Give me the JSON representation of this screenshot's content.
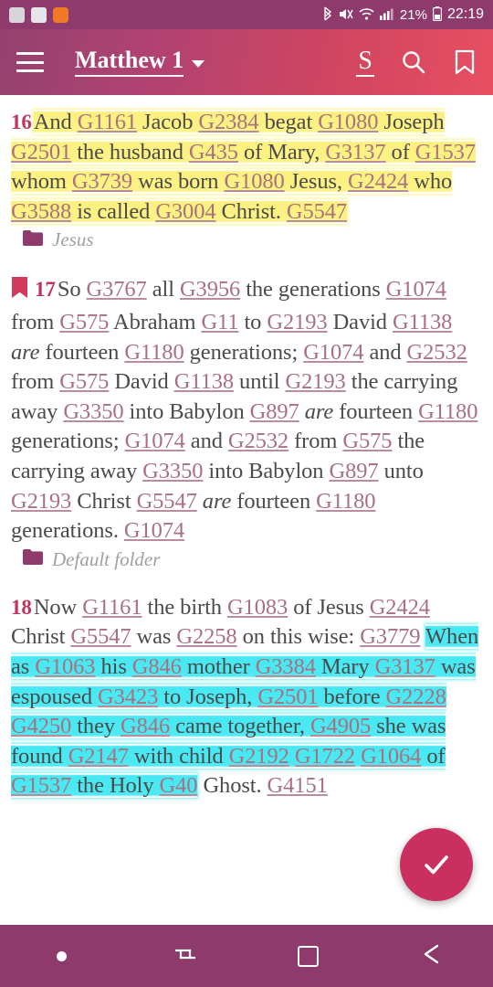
{
  "status_bar": {
    "app_icons": [
      "notification-app-icon-1",
      "gallery-app-icon",
      "orange-app-icon"
    ],
    "bluetooth_glyph": "B",
    "mute_glyph": "X",
    "wifi_glyph": "▰",
    "signal_glyph": "▂",
    "battery_percent": "21%",
    "battery_glyph": "▮",
    "time": "22:19"
  },
  "app_bar": {
    "menu_icon": "hamburger-menu-icon",
    "chapter": "Matthew 1",
    "chapter_caret": "chevron-down-icon",
    "strongs_label": "S",
    "search_icon": "search-icon",
    "bookmark_icon": "bookmark-icon"
  },
  "content": {
    "verses": [
      {
        "number": "16",
        "highlight": "yellow",
        "bookmark": false,
        "folder": "Jesus",
        "tokens": [
          {
            "t": "And ",
            "k": "text"
          },
          {
            "t": "G1161",
            "k": "strongs"
          },
          {
            "t": " Jacob ",
            "k": "text"
          },
          {
            "t": "G2384",
            "k": "strongs"
          },
          {
            "t": " begat ",
            "k": "text"
          },
          {
            "t": "G1080",
            "k": "strongs"
          },
          {
            "t": " Joseph ",
            "k": "text"
          },
          {
            "t": "G2501",
            "k": "strongs"
          },
          {
            "t": " the husband ",
            "k": "text"
          },
          {
            "t": "G435",
            "k": "strongs"
          },
          {
            "t": " of Mary, ",
            "k": "text"
          },
          {
            "t": "G3137",
            "k": "strongs"
          },
          {
            "t": " of ",
            "k": "text"
          },
          {
            "t": "G1537",
            "k": "strongs"
          },
          {
            "t": " whom ",
            "k": "text"
          },
          {
            "t": "G3739",
            "k": "strongs"
          },
          {
            "t": " was born ",
            "k": "text"
          },
          {
            "t": "G1080",
            "k": "strongs"
          },
          {
            "t": " Jesus, ",
            "k": "text"
          },
          {
            "t": "G2424",
            "k": "strongs"
          },
          {
            "t": " who ",
            "k": "text"
          },
          {
            "t": "G3588",
            "k": "strongs"
          },
          {
            "t": " is called ",
            "k": "text"
          },
          {
            "t": "G3004",
            "k": "strongs"
          },
          {
            "t": " Christ. ",
            "k": "text"
          },
          {
            "t": "G5547",
            "k": "strongs"
          }
        ]
      },
      {
        "number": "17",
        "highlight": "none",
        "bookmark": true,
        "folder": "Default folder",
        "tokens": [
          {
            "t": "So ",
            "k": "text"
          },
          {
            "t": "G3767",
            "k": "strongs"
          },
          {
            "t": " all ",
            "k": "text"
          },
          {
            "t": "G3956",
            "k": "strongs"
          },
          {
            "t": " the generations ",
            "k": "text"
          },
          {
            "t": "G1074",
            "k": "strongs"
          },
          {
            "t": " from ",
            "k": "text"
          },
          {
            "t": "G575",
            "k": "strongs"
          },
          {
            "t": " Abraham ",
            "k": "text"
          },
          {
            "t": "G11",
            "k": "strongs"
          },
          {
            "t": " to ",
            "k": "text"
          },
          {
            "t": "G2193",
            "k": "strongs"
          },
          {
            "t": " David ",
            "k": "text"
          },
          {
            "t": "G1138",
            "k": "strongs"
          },
          {
            "t": " are",
            "k": "italic"
          },
          {
            "t": " fourteen ",
            "k": "text"
          },
          {
            "t": "G1180",
            "k": "strongs"
          },
          {
            "t": " generations; ",
            "k": "text"
          },
          {
            "t": "G1074",
            "k": "strongs"
          },
          {
            "t": " and ",
            "k": "text"
          },
          {
            "t": "G2532",
            "k": "strongs"
          },
          {
            "t": " from ",
            "k": "text"
          },
          {
            "t": "G575",
            "k": "strongs"
          },
          {
            "t": " David ",
            "k": "text"
          },
          {
            "t": "G1138",
            "k": "strongs"
          },
          {
            "t": " until ",
            "k": "text"
          },
          {
            "t": "G2193",
            "k": "strongs"
          },
          {
            "t": " the carrying away ",
            "k": "text"
          },
          {
            "t": "G3350",
            "k": "strongs"
          },
          {
            "t": " into Babylon ",
            "k": "text"
          },
          {
            "t": "G897",
            "k": "strongs"
          },
          {
            "t": " are",
            "k": "italic"
          },
          {
            "t": " fourteen ",
            "k": "text"
          },
          {
            "t": "G1180",
            "k": "strongs"
          },
          {
            "t": " generations; ",
            "k": "text"
          },
          {
            "t": "G1074",
            "k": "strongs"
          },
          {
            "t": " and ",
            "k": "text"
          },
          {
            "t": "G2532",
            "k": "strongs"
          },
          {
            "t": " from ",
            "k": "text"
          },
          {
            "t": "G575",
            "k": "strongs"
          },
          {
            "t": " the carrying away ",
            "k": "text"
          },
          {
            "t": "G3350",
            "k": "strongs"
          },
          {
            "t": " into Babylon ",
            "k": "text"
          },
          {
            "t": "G897",
            "k": "strongs"
          },
          {
            "t": " unto ",
            "k": "text"
          },
          {
            "t": "G2193",
            "k": "strongs"
          },
          {
            "t": " Christ ",
            "k": "text"
          },
          {
            "t": "G5547",
            "k": "strongs"
          },
          {
            "t": " are",
            "k": "italic"
          },
          {
            "t": " fourteen ",
            "k": "text"
          },
          {
            "t": "G1180",
            "k": "strongs"
          },
          {
            "t": " generations. ",
            "k": "text"
          },
          {
            "t": "G1074",
            "k": "strongs"
          }
        ]
      },
      {
        "number": "18",
        "highlight": "cyan-partial",
        "bookmark": false,
        "folder": null,
        "tokens": [
          {
            "t": "Now ",
            "k": "text"
          },
          {
            "t": "G1161",
            "k": "strongs"
          },
          {
            "t": " the birth ",
            "k": "text"
          },
          {
            "t": "G1083",
            "k": "strongs"
          },
          {
            "t": " of Jesus ",
            "k": "text"
          },
          {
            "t": "G2424",
            "k": "strongs"
          },
          {
            "t": " Christ ",
            "k": "text"
          },
          {
            "t": "G5547",
            "k": "strongs"
          },
          {
            "t": " was ",
            "k": "text"
          },
          {
            "t": "G2258",
            "k": "strongs"
          },
          {
            "t": " on this wise: ",
            "k": "text"
          },
          {
            "t": "G3779",
            "k": "strongs"
          },
          {
            "t": " ",
            "k": "text"
          },
          {
            "t": "When as ",
            "k": "hl-text"
          },
          {
            "t": "G1063",
            "k": "hl-strongs"
          },
          {
            "t": " his ",
            "k": "hl-text"
          },
          {
            "t": "G846",
            "k": "hl-strongs"
          },
          {
            "t": " mother ",
            "k": "hl-text"
          },
          {
            "t": "G3384",
            "k": "hl-strongs"
          },
          {
            "t": " Mary ",
            "k": "hl-text"
          },
          {
            "t": "G3137",
            "k": "hl-strongs"
          },
          {
            "t": " was espoused ",
            "k": "hl-text"
          },
          {
            "t": "G3423",
            "k": "hl-strongs"
          },
          {
            "t": " to Joseph, ",
            "k": "hl-text"
          },
          {
            "t": "G2501",
            "k": "hl-strongs"
          },
          {
            "t": " before ",
            "k": "hl-text"
          },
          {
            "t": "G2228",
            "k": "hl-strongs"
          },
          {
            "t": " ",
            "k": "hl-text"
          },
          {
            "t": "G4250",
            "k": "hl-strongs"
          },
          {
            "t": " they ",
            "k": "hl-text"
          },
          {
            "t": "G846",
            "k": "hl-strongs"
          },
          {
            "t": " came together, ",
            "k": "hl-text"
          },
          {
            "t": "G4905",
            "k": "hl-strongs"
          },
          {
            "t": " she was found ",
            "k": "hl-text"
          },
          {
            "t": "G2147",
            "k": "hl-strongs"
          },
          {
            "t": " with child ",
            "k": "hl-text"
          },
          {
            "t": "G2192",
            "k": "hl-strongs"
          },
          {
            "t": " ",
            "k": "hl-text"
          },
          {
            "t": "G1722",
            "k": "hl-strongs"
          },
          {
            "t": " ",
            "k": "hl-text"
          },
          {
            "t": "G1064",
            "k": "hl-strongs"
          },
          {
            "t": " of ",
            "k": "hl-text"
          },
          {
            "t": "G1537",
            "k": "hl-strongs"
          },
          {
            "t": " the Holy ",
            "k": "hl-text"
          },
          {
            "t": "G40",
            "k": "hl-strongs"
          },
          {
            "t": " Ghost. ",
            "k": "text"
          },
          {
            "t": "G4151",
            "k": "strongs"
          }
        ]
      }
    ]
  },
  "fab": {
    "icon": "check-icon",
    "label": "confirm-selection"
  },
  "nav_bar": {
    "items": [
      {
        "name": "nav-dot-indicator",
        "icon": "dot-icon"
      },
      {
        "name": "nav-switch",
        "icon": "swap-icon"
      },
      {
        "name": "nav-recents",
        "icon": "square-icon"
      },
      {
        "name": "nav-back",
        "icon": "back-arrow-icon"
      }
    ]
  },
  "colors": {
    "appbar_left": "#94416f",
    "appbar_right": "#e84f62",
    "statusbar": "#8e3a6d",
    "navbar": "#8e3a6d",
    "fab": "#cb2f5f",
    "verse_number": "#c1355c",
    "strongs_link": "#a9717f",
    "body_text": "#4b4b4b",
    "highlight_yellow": "#fcf07e",
    "highlight_cyan": "#46e8f2",
    "folder_icon": "#8e3a6d",
    "folder_label": "#a0a0a0",
    "bookmark_icon": "#d13a5c"
  }
}
